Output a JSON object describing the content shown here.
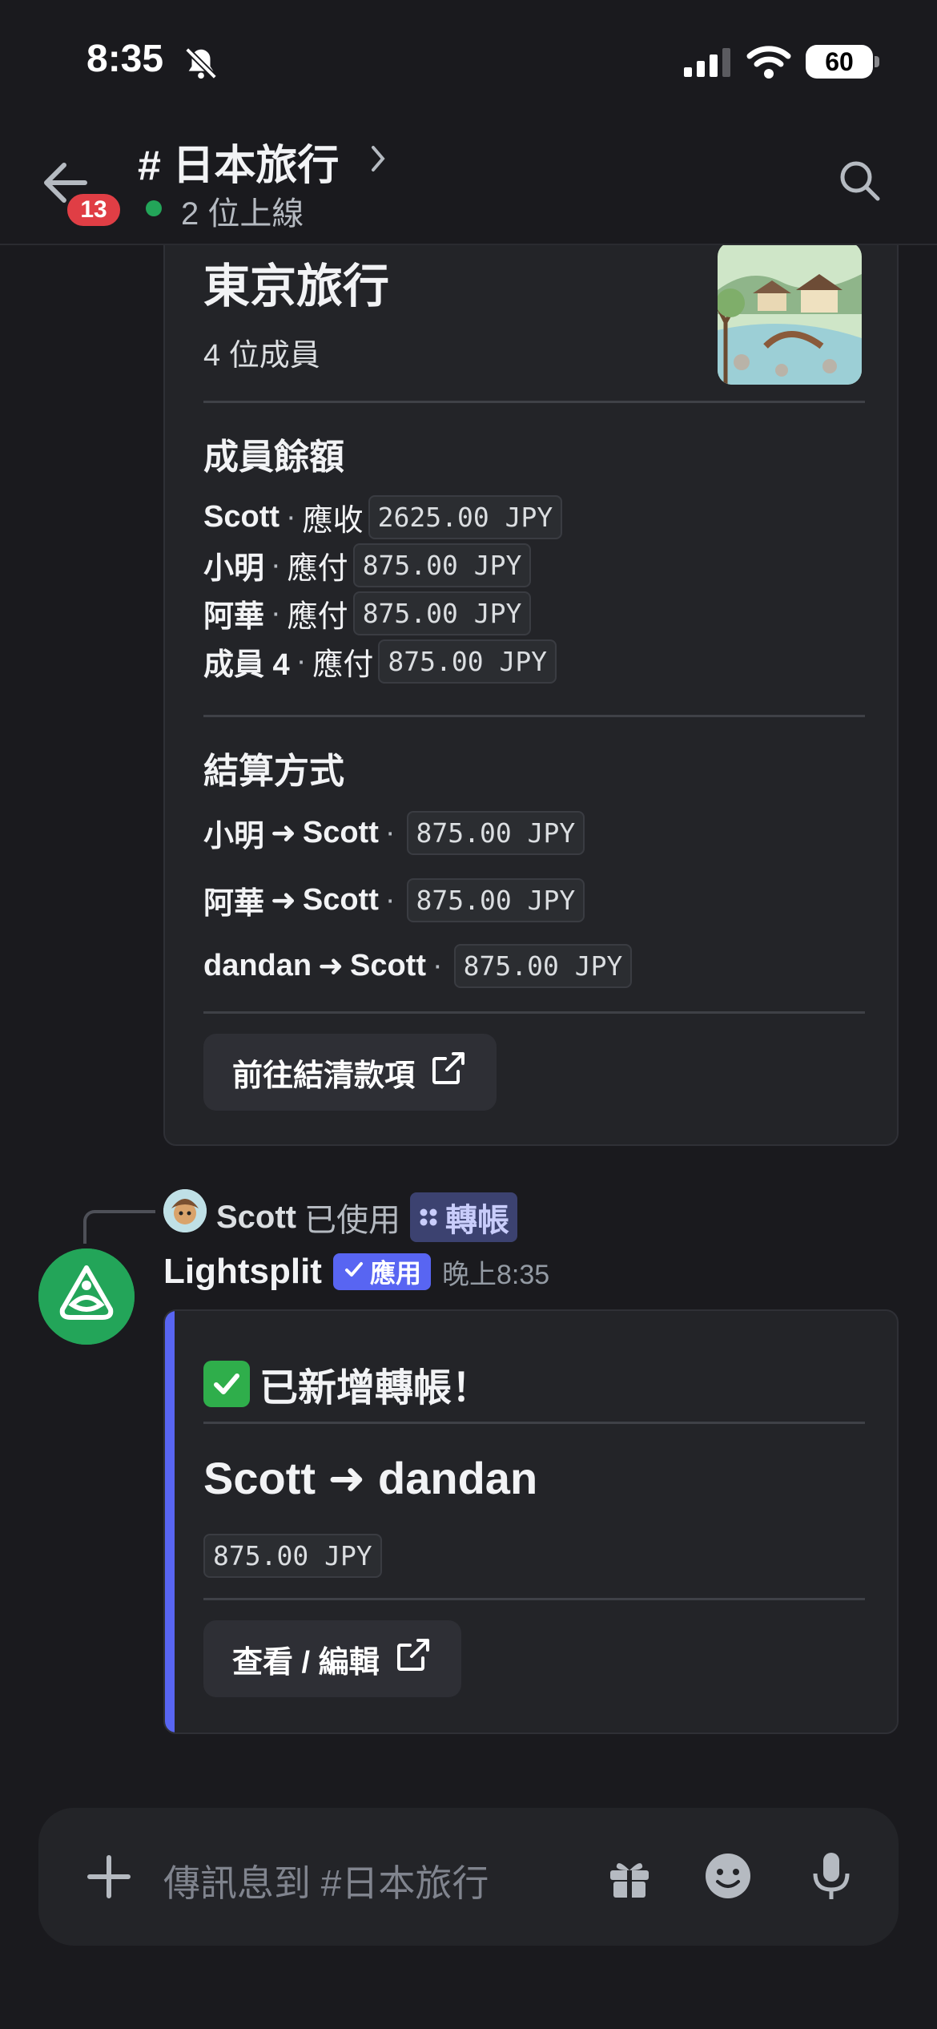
{
  "status_bar": {
    "time": "8:35",
    "battery": "60"
  },
  "header": {
    "back_badge": "13",
    "channel_title": "# 日本旅行",
    "online_text": "2 位上線"
  },
  "embed_summary": {
    "title": "東京旅行",
    "member_count": "4 位成員",
    "balances_title": "成員餘額",
    "balances": [
      {
        "name": "Scott",
        "sep": "·",
        "action": "應收",
        "amount": "2625.00 JPY"
      },
      {
        "name": "小明",
        "sep": "·",
        "action": "應付",
        "amount": "875.00 JPY"
      },
      {
        "name": "阿華",
        "sep": "·",
        "action": "應付",
        "amount": "875.00 JPY"
      },
      {
        "name": "成員 4",
        "sep": "·",
        "action": "應付",
        "amount": "875.00 JPY"
      }
    ],
    "settle_title": "結算方式",
    "settlements": [
      {
        "from": "小明",
        "arrow": "➜",
        "to": "Scott",
        "sep": "·",
        "amount": "875.00 JPY"
      },
      {
        "from": "阿華",
        "arrow": "➜",
        "to": "Scott",
        "sep": "·",
        "amount": "875.00 JPY"
      },
      {
        "from": "dandan",
        "arrow": "➜",
        "to": "Scott",
        "sep": "·",
        "amount": "875.00 JPY"
      }
    ],
    "button_label": "前往結清款項"
  },
  "reply": {
    "user": "Scott",
    "used_text": "已使用",
    "command": "轉帳"
  },
  "message": {
    "author": "Lightsplit",
    "app_tag": "應用",
    "time": "晚上8:35"
  },
  "embed_transfer": {
    "title": "已新增轉帳！",
    "transfer": "Scott ➜ dandan",
    "amount": "875.00 JPY",
    "button_label": "查看 / 編輯"
  },
  "input": {
    "placeholder": "傳訊息到 #日本旅行"
  },
  "colors": {
    "accent": "#5865f2",
    "online": "#23a559",
    "badge": "#e03e45"
  }
}
